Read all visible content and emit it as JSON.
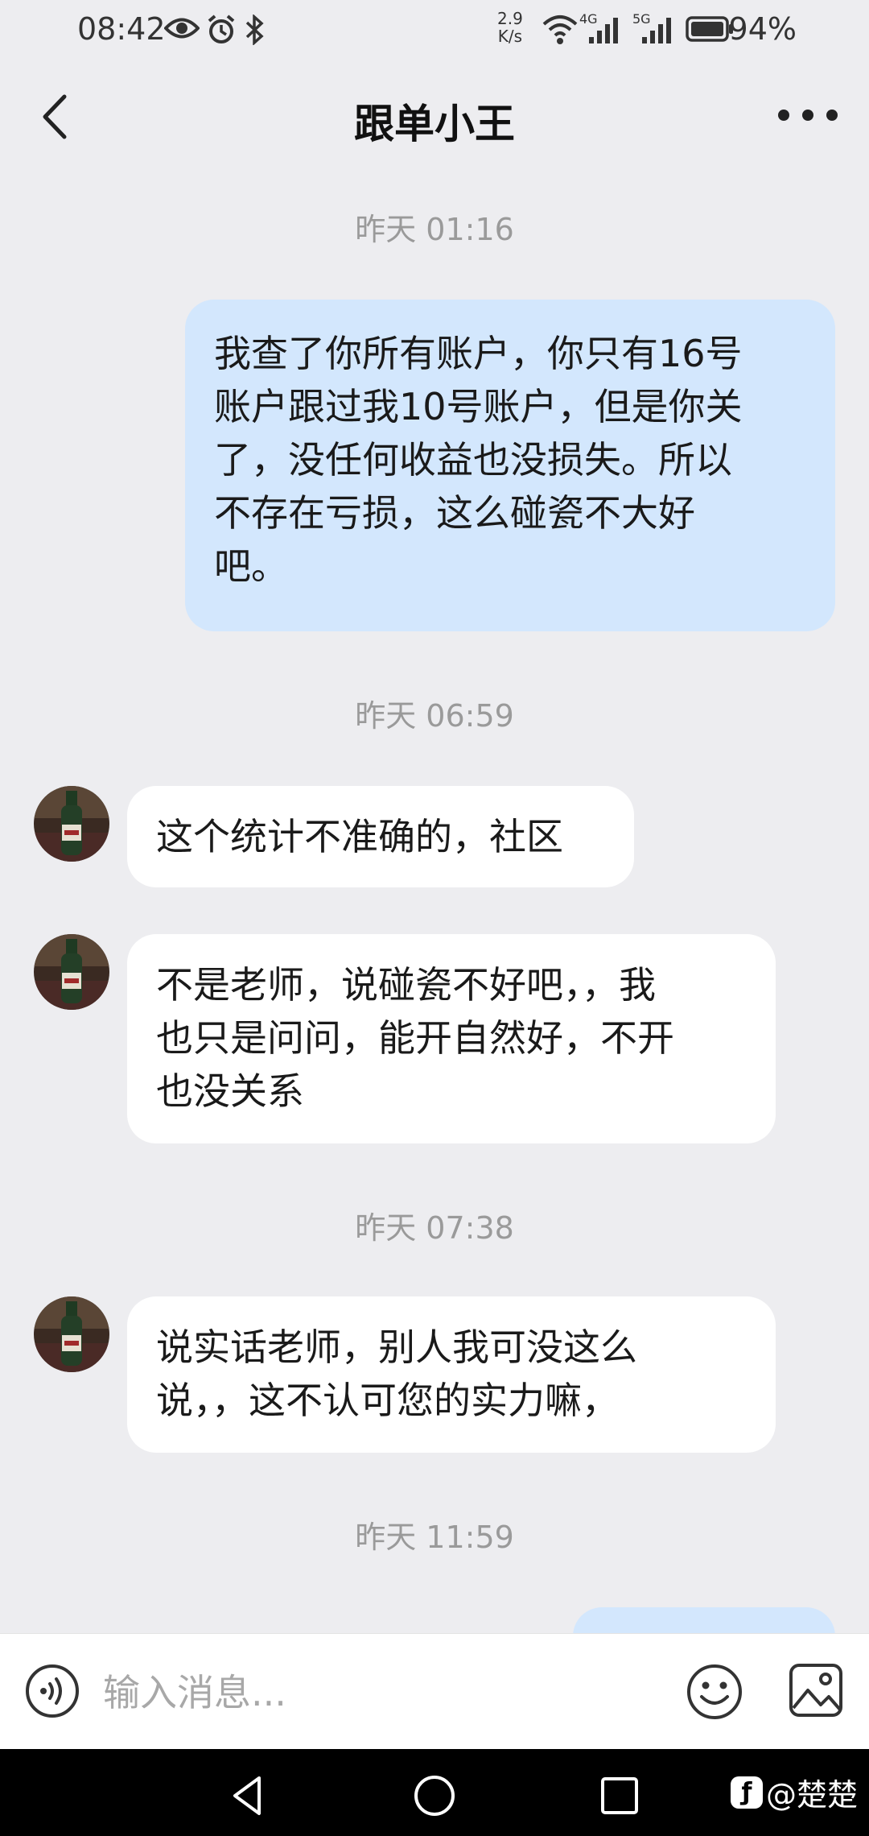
{
  "status_bar": {
    "time": "08:42",
    "net_speed_value": "2.9",
    "net_speed_unit": "K/s",
    "net_4g": "4G",
    "net_5g": "5G",
    "battery": "94%"
  },
  "header": {
    "title": "跟单小王"
  },
  "messages": [
    {
      "type": "timestamp",
      "text": "昨天 01:16"
    },
    {
      "type": "outgoing",
      "lines": [
        "我查了你所有账户，你只有16号",
        "账户跟过我10号账户，但是你关",
        "了，没任何收益也没损失。所以",
        "不存在亏损，这么碰瓷不大好",
        "吧。"
      ]
    },
    {
      "type": "timestamp",
      "text": "昨天 06:59"
    },
    {
      "type": "incoming",
      "lines": [
        "这个统计不准确的，社区"
      ]
    },
    {
      "type": "incoming",
      "lines": [
        "不是老师，说碰瓷不好吧，，我",
        "也只是问问，能开自然好，不开",
        "也没关系"
      ]
    },
    {
      "type": "timestamp",
      "text": "昨天 07:38"
    },
    {
      "type": "incoming",
      "lines": [
        "说实话老师，别人我可没这么",
        "说，，这不认可您的实力嘛，"
      ]
    },
    {
      "type": "timestamp",
      "text": "昨天 11:59"
    }
  ],
  "input_bar": {
    "placeholder": "输入消息..."
  },
  "watermark": {
    "text": "@楚楚"
  },
  "icons": {
    "back": "chevron-left-icon",
    "more": "more-dots-icon",
    "voice": "voice-icon",
    "emoji": "emoji-icon",
    "image": "image-icon"
  },
  "colors": {
    "background": "#ededf0",
    "outgoing_bubble": "#d3e7fd",
    "incoming_bubble": "#ffffff",
    "timestamp": "#9a9a9a"
  }
}
